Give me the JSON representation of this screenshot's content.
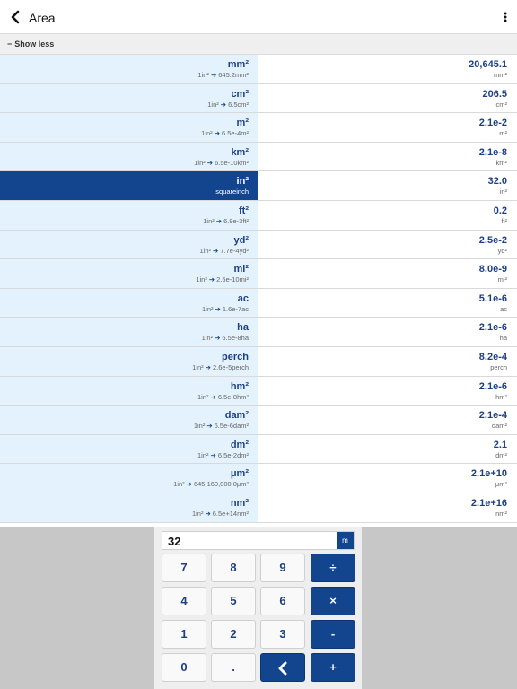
{
  "header": {
    "title": "Area",
    "back_icon": "chevron-left-icon",
    "menu_icon": "more-vertical-icon"
  },
  "toggle": {
    "minus": "−",
    "label": "Show less"
  },
  "arrow": "➔",
  "rows": [
    {
      "unit": "mm²",
      "conv_from": "1in²",
      "conv_to": "645.2mm²",
      "value": "20,645.1",
      "value_unit": "mm²"
    },
    {
      "unit": "cm²",
      "conv_from": "1in²",
      "conv_to": "6.5cm²",
      "value": "206.5",
      "value_unit": "cm²"
    },
    {
      "unit": "m²",
      "conv_from": "1in²",
      "conv_to": "6.5e-4m²",
      "value": "2.1e-2",
      "value_unit": "m²"
    },
    {
      "unit": "km²",
      "conv_from": "1in²",
      "conv_to": "6.5e-10km²",
      "value": "2.1e-8",
      "value_unit": "km²"
    },
    {
      "unit": "in²",
      "desc": "squareinch",
      "value": "32.0",
      "value_unit": "in²"
    },
    {
      "unit": "ft²",
      "conv_from": "1in²",
      "conv_to": "6.9e-3ft²",
      "value": "0.2",
      "value_unit": "ft²"
    },
    {
      "unit": "yd²",
      "conv_from": "1in²",
      "conv_to": "7.7e-4yd²",
      "value": "2.5e-2",
      "value_unit": "yd²"
    },
    {
      "unit": "mi²",
      "conv_from": "1in²",
      "conv_to": "2.5e-10mi²",
      "value": "8.0e-9",
      "value_unit": "mi²"
    },
    {
      "unit": "ac",
      "conv_from": "1in²",
      "conv_to": "1.6e-7ac",
      "value": "5.1e-6",
      "value_unit": "ac"
    },
    {
      "unit": "ha",
      "conv_from": "1in²",
      "conv_to": "6.5e-8ha",
      "value": "2.1e-6",
      "value_unit": "ha"
    },
    {
      "unit": "perch",
      "conv_from": "1in²",
      "conv_to": "2.6e-5perch",
      "value": "8.2e-4",
      "value_unit": "perch"
    },
    {
      "unit": "hm²",
      "conv_from": "1in²",
      "conv_to": "6.5e-8hm²",
      "value": "2.1e-6",
      "value_unit": "hm²"
    },
    {
      "unit": "dam²",
      "conv_from": "1in²",
      "conv_to": "6.5e-6dam²",
      "value": "2.1e-4",
      "value_unit": "dam²"
    },
    {
      "unit": "dm²",
      "conv_from": "1in²",
      "conv_to": "6.5e-2dm²",
      "value": "2.1",
      "value_unit": "dm²"
    },
    {
      "unit": "μm²",
      "conv_from": "1in²",
      "conv_to": "645,160,000.0μm²",
      "value": "2.1e+10",
      "value_unit": "μm²"
    },
    {
      "unit": "nm²",
      "conv_from": "1in²",
      "conv_to": "6.5e+14nm²",
      "value": "2.1e+16",
      "value_unit": "nm²"
    }
  ],
  "selected_row_index": 4,
  "calculator": {
    "display_value": "32",
    "unit_button": "m",
    "keys": [
      {
        "label": "7",
        "name": "key-7",
        "type": "digit"
      },
      {
        "label": "8",
        "name": "key-8",
        "type": "digit"
      },
      {
        "label": "9",
        "name": "key-9",
        "type": "digit"
      },
      {
        "label": "÷",
        "name": "key-divide",
        "type": "op"
      },
      {
        "label": "4",
        "name": "key-4",
        "type": "digit"
      },
      {
        "label": "5",
        "name": "key-5",
        "type": "digit"
      },
      {
        "label": "6",
        "name": "key-6",
        "type": "digit"
      },
      {
        "label": "×",
        "name": "key-multiply",
        "type": "op"
      },
      {
        "label": "1",
        "name": "key-1",
        "type": "digit"
      },
      {
        "label": "2",
        "name": "key-2",
        "type": "digit"
      },
      {
        "label": "3",
        "name": "key-3",
        "type": "digit"
      },
      {
        "label": "-",
        "name": "key-minus",
        "type": "op"
      },
      {
        "label": "0",
        "name": "key-0",
        "type": "digit"
      },
      {
        "label": ".",
        "name": "key-decimal",
        "type": "digit"
      },
      {
        "label": "",
        "name": "key-backspace",
        "type": "op",
        "icon": "backspace-chevron-icon"
      },
      {
        "label": "+",
        "name": "key-plus",
        "type": "op"
      }
    ]
  },
  "colors": {
    "accent": "#12458e",
    "text_accent": "#1c3e85",
    "unit_column_bg": "#e3f2fc",
    "panel_bg": "#c7c7c7"
  }
}
